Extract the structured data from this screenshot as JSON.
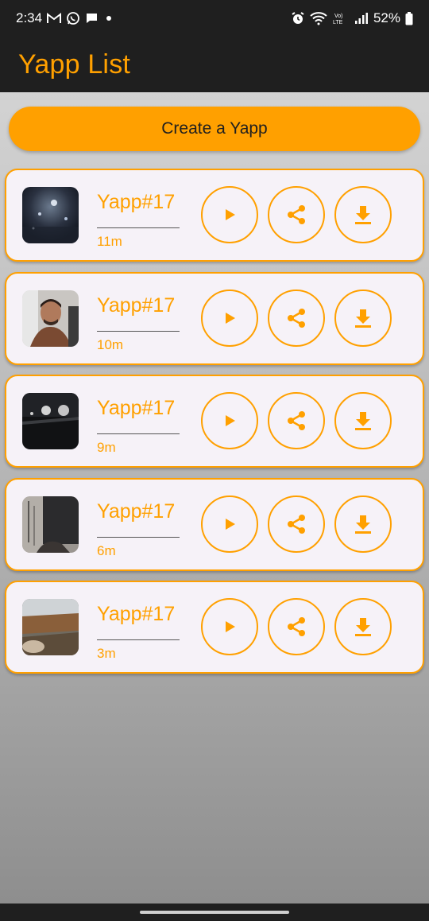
{
  "status_bar": {
    "time": "2:34",
    "battery": "52%",
    "icons": [
      "gmail-icon",
      "whatsapp-icon",
      "chat-icon",
      "dot-icon",
      "alarm-icon",
      "wifi-icon",
      "volte-icon",
      "signal-icon",
      "battery-icon"
    ]
  },
  "app_bar": {
    "title": "Yapp List"
  },
  "create_button": {
    "label": "Create a Yapp"
  },
  "yapps": [
    {
      "name": "Yapp#17",
      "time": "11m",
      "thumbnail": "night-city-photo"
    },
    {
      "name": "Yapp#17",
      "time": "10m",
      "thumbnail": "selfie-photo"
    },
    {
      "name": "Yapp#17",
      "time": "9m",
      "thumbnail": "dark-lights-photo"
    },
    {
      "name": "Yapp#17",
      "time": "6m",
      "thumbnail": "room-photo"
    },
    {
      "name": "Yapp#17",
      "time": "3m",
      "thumbnail": "blurry-photo"
    }
  ],
  "actions": [
    "play-icon",
    "share-icon",
    "download-icon"
  ],
  "colors": {
    "accent": "#ffa000",
    "app_bar": "#1f1f1f",
    "card_bg": "#f6f2f8",
    "button_text": "#1f1f1f"
  }
}
